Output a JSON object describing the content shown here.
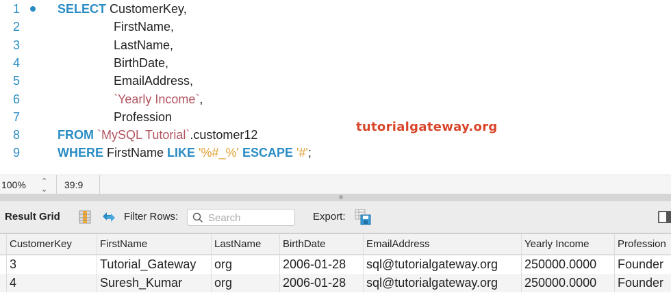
{
  "editor": {
    "lines": [
      {
        "num": "1",
        "parts": [
          {
            "t": "SELECT",
            "c": "kw"
          },
          {
            "t": " CustomerKey,",
            "c": ""
          }
        ],
        "indent": false,
        "dot": true
      },
      {
        "num": "2",
        "parts": [
          {
            "t": "FirstName,",
            "c": ""
          }
        ],
        "indent": true
      },
      {
        "num": "3",
        "parts": [
          {
            "t": "LastName,",
            "c": ""
          }
        ],
        "indent": true
      },
      {
        "num": "4",
        "parts": [
          {
            "t": "BirthDate,",
            "c": ""
          }
        ],
        "indent": true
      },
      {
        "num": "5",
        "parts": [
          {
            "t": "EmailAddress,",
            "c": ""
          }
        ],
        "indent": true
      },
      {
        "num": "6",
        "parts": [
          {
            "t": "`Yearly Income`",
            "c": "bt"
          },
          {
            "t": ",",
            "c": ""
          }
        ],
        "indent": true
      },
      {
        "num": "7",
        "parts": [
          {
            "t": "Profession",
            "c": ""
          }
        ],
        "indent": true
      },
      {
        "num": "8",
        "parts": [
          {
            "t": "FROM",
            "c": "kw"
          },
          {
            "t": " ",
            "c": ""
          },
          {
            "t": "`MySQL Tutorial`",
            "c": "bt"
          },
          {
            "t": ".customer12",
            "c": ""
          }
        ],
        "indent": false
      },
      {
        "num": "9",
        "parts": [
          {
            "t": "WHERE",
            "c": "kw"
          },
          {
            "t": " FirstName ",
            "c": ""
          },
          {
            "t": "LIKE",
            "c": "kw"
          },
          {
            "t": " ",
            "c": ""
          },
          {
            "t": "'%#_%'",
            "c": "str"
          },
          {
            "t": " ",
            "c": ""
          },
          {
            "t": "ESCAPE",
            "c": "kw"
          },
          {
            "t": " ",
            "c": ""
          },
          {
            "t": "'#'",
            "c": "str"
          },
          {
            "t": ";",
            "c": ""
          }
        ],
        "indent": false
      }
    ],
    "watermark": "tutorialgateway.org"
  },
  "status": {
    "zoom": "100%",
    "cursor": "39:9"
  },
  "toolbar": {
    "result_grid": "Result Grid",
    "filter_rows": "Filter Rows:",
    "search_placeholder": "Search",
    "export": "Export:"
  },
  "grid": {
    "columns": [
      "CustomerKey",
      "FirstName",
      "LastName",
      "BirthDate",
      "EmailAddress",
      "Yearly Income",
      "Profession"
    ],
    "rows": [
      [
        "3",
        "Tutorial_Gateway",
        "org",
        "2006-01-28",
        "sql@tutorialgateway.org",
        "250000.0000",
        "Founder"
      ],
      [
        "4",
        "Suresh_Kumar",
        "org",
        "2006-01-28",
        "sql@tutorialgateway.org",
        "250000.0000",
        "Founder"
      ]
    ]
  },
  "colors": {
    "keyword": "#2a8cc4",
    "identifier_quoted": "#b0545e",
    "string": "#e0a030",
    "watermark": "#d9452a"
  }
}
